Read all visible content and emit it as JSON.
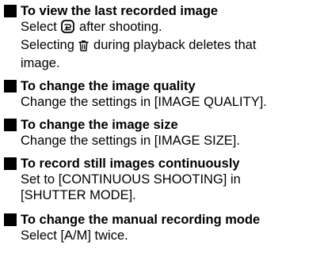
{
  "sections": [
    {
      "heading": "To view the last recorded image",
      "lines": [
        {
          "before": "Select ",
          "icon": "playback-icon",
          "after": " after shooting."
        },
        {
          "before": "Selecting ",
          "icon": "trash-icon",
          "after": " during playback deletes that"
        },
        {
          "text": "image."
        }
      ]
    },
    {
      "heading": "To change the image quality",
      "lines": [
        {
          "text": "Change the settings in [IMAGE QUALITY]."
        }
      ]
    },
    {
      "heading": "To change the image size",
      "lines": [
        {
          "text": "Change the settings in [IMAGE SIZE]."
        }
      ]
    },
    {
      "heading": "To record still images continuously",
      "lines": [
        {
          "text": "Set to [CONTINUOUS SHOOTING] in"
        },
        {
          "text": "[SHUTTER MODE]."
        }
      ]
    },
    {
      "heading": "To change the manual recording mode",
      "lines": [
        {
          "text": "Select [A/M] twice."
        }
      ]
    }
  ]
}
